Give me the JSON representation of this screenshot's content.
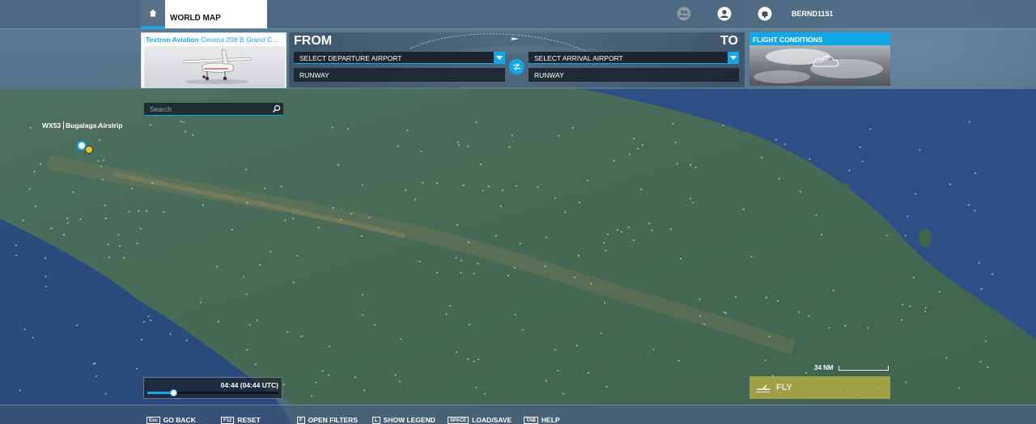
{
  "header": {
    "world_map_tab": "WORLD MAP",
    "username": "BERND1151",
    "icons": [
      "home-icon",
      "friends-icon",
      "profile-icon",
      "notifications-icon"
    ]
  },
  "aircraft": {
    "brand": "Textron Aviation",
    "model": "Cessna 208 B Grand C..."
  },
  "route": {
    "from_label": "FROM",
    "to_label": "TO",
    "departure": "SELECT DEPARTURE AIRPORT",
    "arrival": "SELECT ARRIVAL AIRPORT",
    "departure_runway": "RUNWAY",
    "arrival_runway": "RUNWAY"
  },
  "conditions": {
    "title": "FLIGHT CONDITIONS"
  },
  "search": {
    "placeholder": "Search"
  },
  "map": {
    "airport_code": "WX53",
    "airport_name": "Bugalaga Airstrip",
    "scale": "34 NM"
  },
  "time": {
    "label": "04:44 (04:44 UTC)",
    "progress": 0.2
  },
  "fly": {
    "label": "FLY"
  },
  "footer": {
    "hotkeys": [
      {
        "key": "Esc",
        "label": "GO BACK"
      },
      {
        "key": "F12",
        "label": "RESET"
      },
      {
        "key": "F",
        "label": "OPEN FILTERS"
      },
      {
        "key": "L",
        "label": "SHOW LEGEND"
      },
      {
        "key": "SPACE",
        "label": "LOAD/SAVE"
      },
      {
        "key": "TAB",
        "label": "HELP"
      }
    ]
  },
  "colors": {
    "accent": "#12a8e8",
    "fly_button": "#beb446",
    "sea": "#2c4f86"
  }
}
